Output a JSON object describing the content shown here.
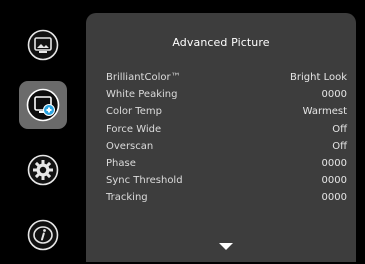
{
  "menu": {
    "title": "Advanced Picture",
    "items": [
      {
        "label": "BrilliantColor™",
        "value": "Bright Look"
      },
      {
        "label": "White Peaking",
        "value": "0000"
      },
      {
        "label": "Color Temp",
        "value": "Warmest"
      },
      {
        "label": "Force Wide",
        "value": "Off"
      },
      {
        "label": "Overscan",
        "value": "Off"
      },
      {
        "label": "Phase",
        "value": "0000"
      },
      {
        "label": "Sync Threshold",
        "value": "0000"
      },
      {
        "label": "Tracking",
        "value": "0000"
      }
    ]
  },
  "sidebar": {
    "icons": [
      {
        "name": "picture-icon",
        "active": false
      },
      {
        "name": "advanced-picture-icon",
        "active": true
      },
      {
        "name": "settings-gear-icon",
        "active": false
      },
      {
        "name": "info-icon",
        "active": false
      }
    ]
  },
  "colors": {
    "background": "#000000",
    "panel": "#3d3d3d",
    "active_tab": "#6b6b6b",
    "text": "#dcdcdc"
  }
}
